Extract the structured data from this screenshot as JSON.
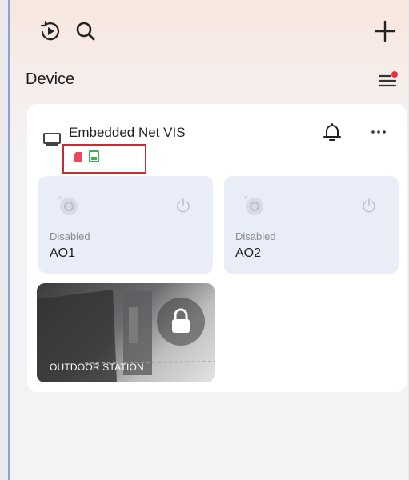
{
  "header": {
    "title": "Device"
  },
  "device": {
    "name": "Embedded Net VIS",
    "colors": {
      "highlight_border": "#c23035",
      "sd_red": "#e84a5c",
      "sd_green": "#38b34a"
    }
  },
  "tiles": [
    {
      "status": "Disabled",
      "name": "AO1"
    },
    {
      "status": "Disabled",
      "name": "AO2"
    }
  ],
  "camera": {
    "label": "OUTDOOR STATION"
  },
  "icons": [
    "playback-icon",
    "search-icon",
    "add-icon",
    "menu-icon",
    "device-icon",
    "bell-icon",
    "more-icon",
    "power-icon",
    "lock-icon"
  ]
}
